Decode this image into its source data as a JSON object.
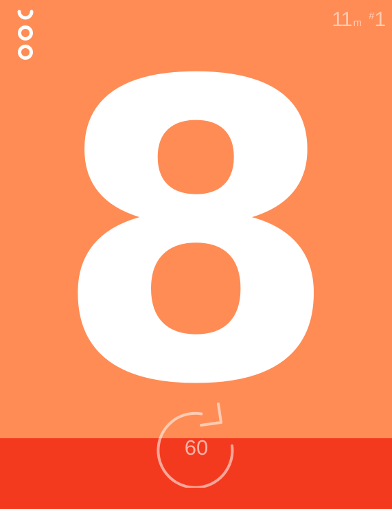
{
  "app": {
    "logo_icon": "ooo-timer-logo-icon"
  },
  "stats": {
    "minutes_value": "11",
    "minutes_unit": "m",
    "round_prefix": "#",
    "round_value": "1"
  },
  "timer": {
    "current_number": "8"
  },
  "restart": {
    "label": "60",
    "icon": "restart-arrow-icon"
  },
  "colors": {
    "background": "#FF8C55",
    "bottom_bar": "#F43A1E",
    "foreground": "#FFFFFF"
  }
}
